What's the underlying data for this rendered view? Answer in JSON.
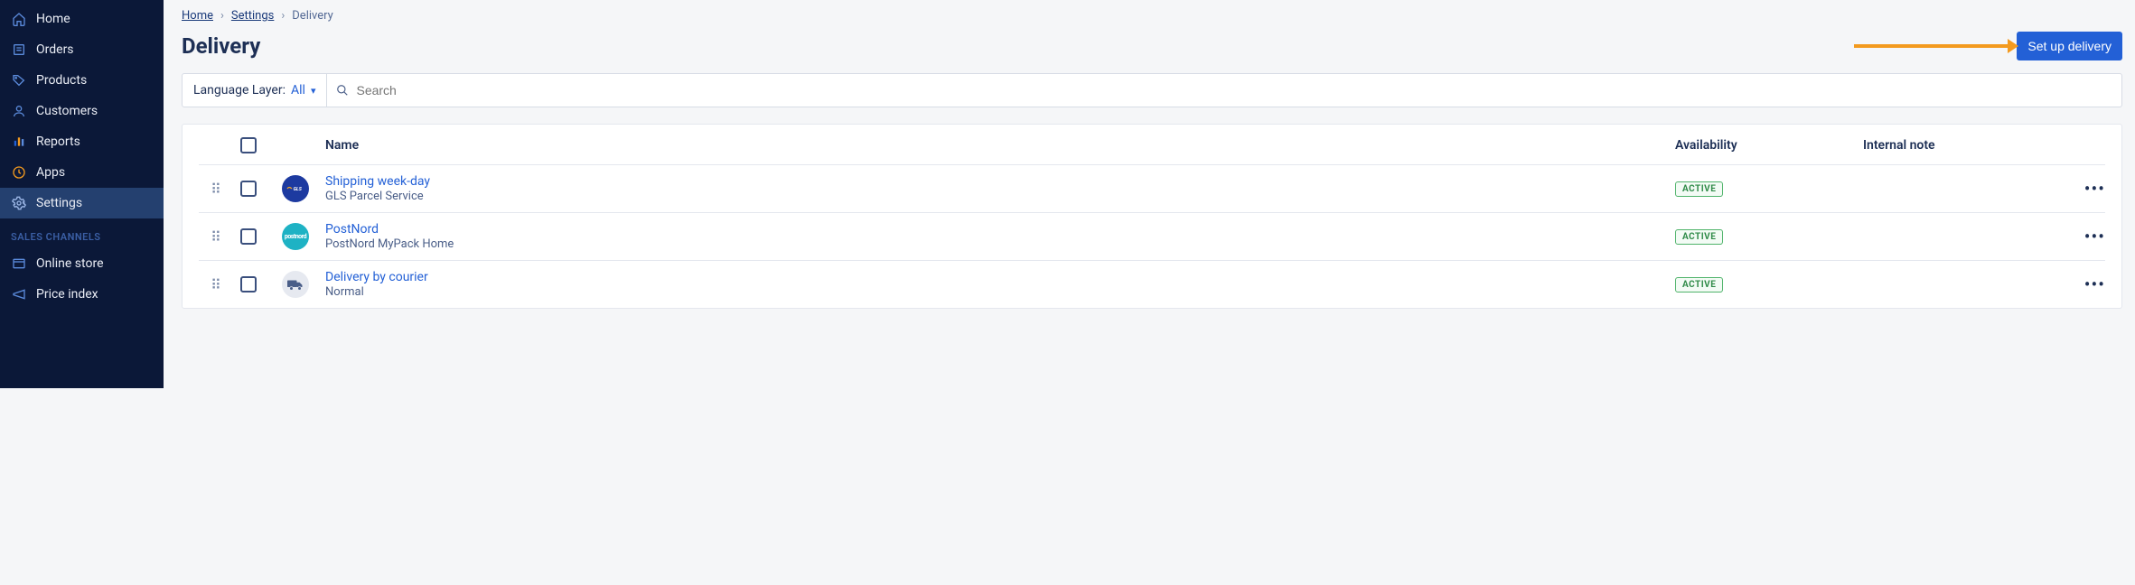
{
  "sidebar": {
    "items": [
      {
        "label": "Home",
        "icon": "home-icon"
      },
      {
        "label": "Orders",
        "icon": "orders-icon"
      },
      {
        "label": "Products",
        "icon": "products-icon"
      },
      {
        "label": "Customers",
        "icon": "customers-icon"
      },
      {
        "label": "Reports",
        "icon": "reports-icon"
      },
      {
        "label": "Apps",
        "icon": "apps-icon"
      },
      {
        "label": "Settings",
        "icon": "settings-icon"
      }
    ],
    "section_label": "SALES CHANNELS",
    "channels": [
      {
        "label": "Online store",
        "icon": "online-store-icon"
      },
      {
        "label": "Price index",
        "icon": "price-index-icon"
      }
    ]
  },
  "breadcrumb": {
    "home": "Home",
    "settings": "Settings",
    "current": "Delivery"
  },
  "page": {
    "title": "Delivery",
    "primary_action": "Set up delivery"
  },
  "filter": {
    "language_label": "Language Layer:",
    "language_value": "All",
    "search_placeholder": "Search"
  },
  "table": {
    "headers": {
      "name": "Name",
      "availability": "Availability",
      "internal_note": "Internal note"
    },
    "rows": [
      {
        "title": "Shipping week-day",
        "subtitle": "GLS Parcel Service",
        "status": "ACTIVE",
        "avatar": "gls",
        "avatar_text": "GLS"
      },
      {
        "title": "PostNord",
        "subtitle": "PostNord MyPack Home",
        "status": "ACTIVE",
        "avatar": "postnord",
        "avatar_text": "postnord"
      },
      {
        "title": "Delivery by courier",
        "subtitle": "Normal",
        "status": "ACTIVE",
        "avatar": "generic"
      }
    ]
  }
}
